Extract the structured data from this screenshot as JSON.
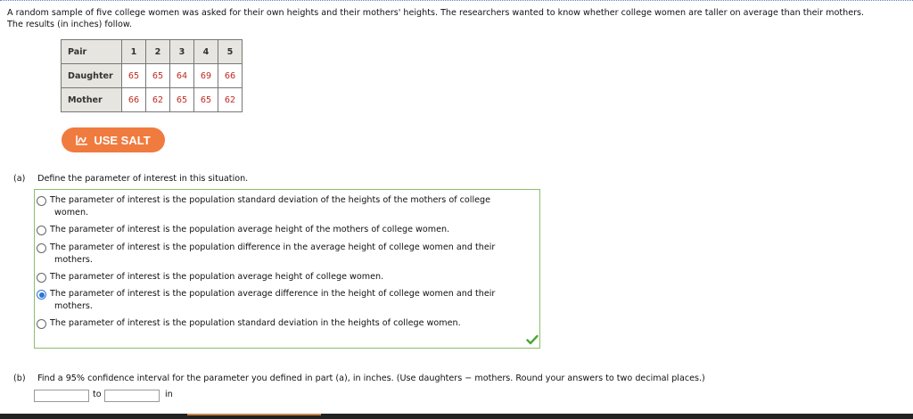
{
  "intro": {
    "line1": "A random sample of five college women was asked for their own heights and their mothers' heights. The researchers wanted to know whether college women are taller on average than their mothers.",
    "line2": "The results (in inches) follow."
  },
  "table": {
    "pair_label": "Pair",
    "pairs": [
      "1",
      "2",
      "3",
      "4",
      "5"
    ],
    "daughter_label": "Daughter",
    "daughter": [
      "65",
      "65",
      "64",
      "69",
      "66"
    ],
    "mother_label": "Mother",
    "mother": [
      "66",
      "62",
      "65",
      "65",
      "62"
    ]
  },
  "salt_button": {
    "label": "USE SALT",
    "icon": "salt-icon",
    "color": "#f07b3f"
  },
  "part_a": {
    "label": "(a)",
    "question": "Define the parameter of interest in this situation.",
    "options": [
      {
        "line1": "The parameter of interest is the population standard deviation of the heights of the mothers of college",
        "line2": "women.",
        "selected": false
      },
      {
        "line1": "The parameter of interest is the population average height of the mothers of college women.",
        "line2": "",
        "selected": false
      },
      {
        "line1": "The parameter of interest is the population difference in the average height of college women and their",
        "line2": "mothers.",
        "selected": false
      },
      {
        "line1": "The parameter of interest is the population average height of college women.",
        "line2": "",
        "selected": false
      },
      {
        "line1": "The parameter of interest is the population average difference in the height of college women and their",
        "line2": "mothers.",
        "selected": true
      },
      {
        "line1": "The parameter of interest is the population standard deviation in the heights of college women.",
        "line2": "",
        "selected": false
      }
    ],
    "status_icon": "checkmark-icon",
    "correct_color": "#4aa832"
  },
  "part_b": {
    "label": "(b)",
    "question": "Find a 95% confidence interval for the parameter you defined in part (a), in inches. (Use daughters − mothers. Round your answers to two decimal places.)",
    "lower_value": "",
    "to_label": "to",
    "upper_value": "",
    "unit_label": "in"
  }
}
